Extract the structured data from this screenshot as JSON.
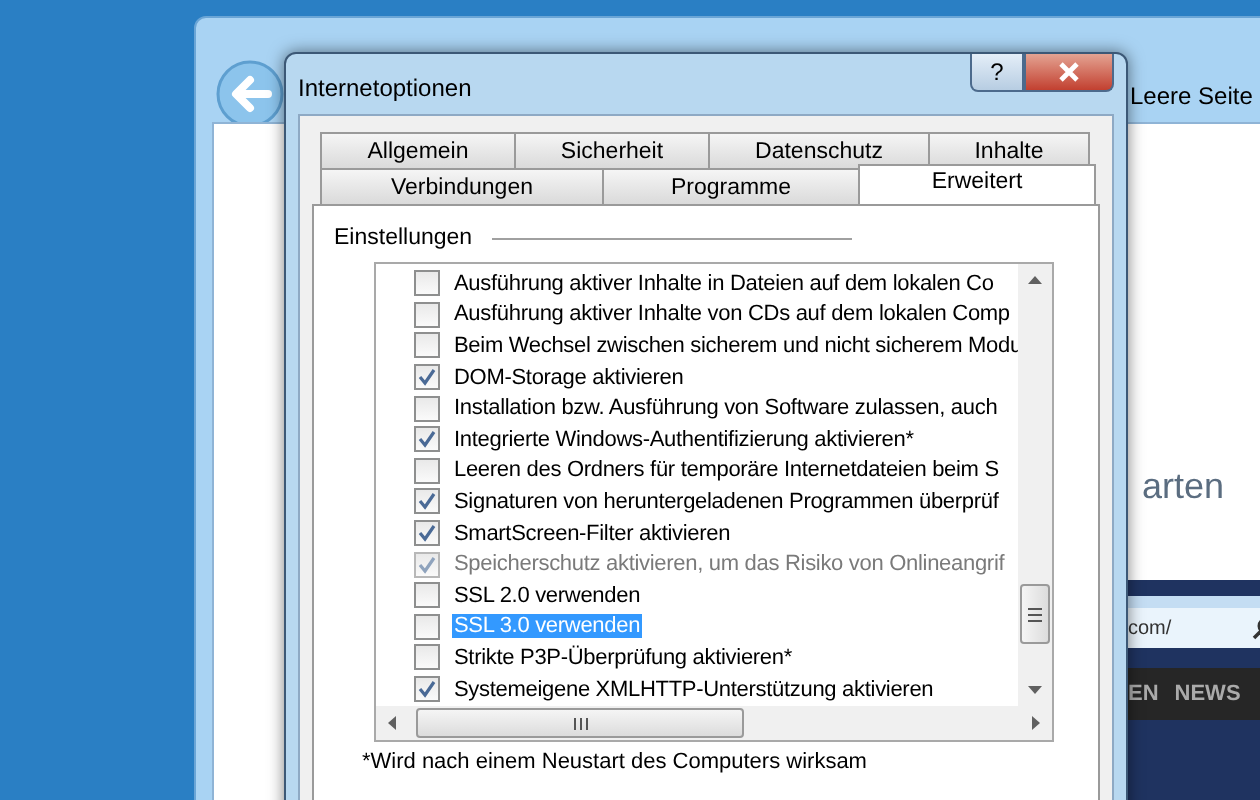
{
  "browser": {
    "tab_title": "Leere Seite",
    "page_text": "arten"
  },
  "browser_2": {
    "address": "com/",
    "nav_items": [
      "EN",
      "NEWS"
    ]
  },
  "dialog": {
    "title": "Internetoptionen",
    "help_button": "?",
    "tab_rows": [
      [
        {
          "label": "Allgemein",
          "selected": false
        },
        {
          "label": "Sicherheit",
          "selected": false
        },
        {
          "label": "Datenschutz",
          "selected": false
        },
        {
          "label": "Inhalte",
          "selected": false
        }
      ],
      [
        {
          "label": "Verbindungen",
          "selected": false
        },
        {
          "label": "Programme",
          "selected": false
        },
        {
          "label": "Erweitert",
          "selected": true
        }
      ]
    ],
    "group_label": "Einstellungen",
    "settings": [
      {
        "label": "Ausführung aktiver Inhalte in Dateien auf dem lokalen Co",
        "checked": false,
        "disabled": false,
        "selected": false
      },
      {
        "label": "Ausführung aktiver Inhalte von CDs auf dem lokalen Comp",
        "checked": false,
        "disabled": false,
        "selected": false
      },
      {
        "label": "Beim Wechsel zwischen sicherem und nicht sicherem Modu",
        "checked": false,
        "disabled": false,
        "selected": false
      },
      {
        "label": "DOM-Storage aktivieren",
        "checked": true,
        "disabled": false,
        "selected": false
      },
      {
        "label": "Installation bzw. Ausführung von Software zulassen, auch",
        "checked": false,
        "disabled": false,
        "selected": false
      },
      {
        "label": "Integrierte Windows-Authentifizierung aktivieren*",
        "checked": true,
        "disabled": false,
        "selected": false
      },
      {
        "label": "Leeren des Ordners für temporäre Internetdateien beim S",
        "checked": false,
        "disabled": false,
        "selected": false
      },
      {
        "label": "Signaturen von heruntergeladenen Programmen überprüf",
        "checked": true,
        "disabled": false,
        "selected": false
      },
      {
        "label": "SmartScreen-Filter aktivieren",
        "checked": true,
        "disabled": false,
        "selected": false
      },
      {
        "label": "Speicherschutz aktivieren, um das Risiko von Onlineangrif",
        "checked": true,
        "disabled": true,
        "selected": false
      },
      {
        "label": "SSL 2.0 verwenden",
        "checked": false,
        "disabled": false,
        "selected": false
      },
      {
        "label": "SSL 3.0 verwenden",
        "checked": false,
        "disabled": false,
        "selected": true
      },
      {
        "label": "Strikte P3P-Überprüfung aktivieren*",
        "checked": false,
        "disabled": false,
        "selected": false
      },
      {
        "label": "Systemeigene XMLHTTP-Unterstützung aktivieren",
        "checked": true,
        "disabled": false,
        "selected": false
      }
    ],
    "footnote": "*Wird nach einem Neustart des Computers wirksam"
  }
}
